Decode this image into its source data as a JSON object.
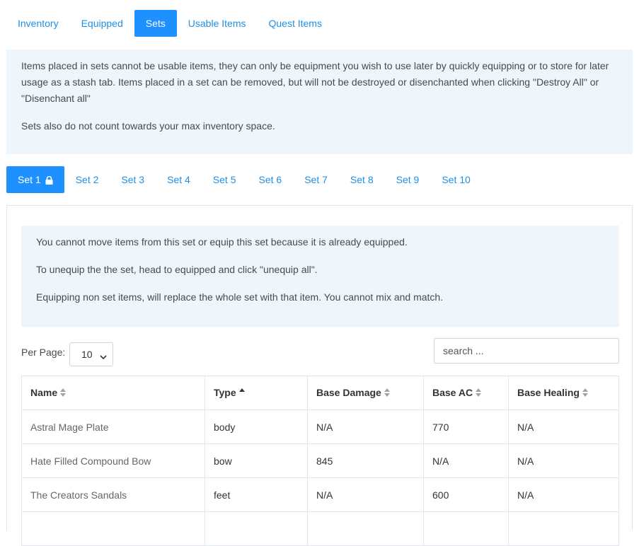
{
  "top_tabs": [
    {
      "label": "Inventory",
      "active": false
    },
    {
      "label": "Equipped",
      "active": false
    },
    {
      "label": "Sets",
      "active": true
    },
    {
      "label": "Usable Items",
      "active": false
    },
    {
      "label": "Quest Items",
      "active": false
    }
  ],
  "info": {
    "p1": "Items placed in sets cannot be usable items, they can only be equipment you wish to use later by quickly equipping or to store for later usage as a stash tab. Items placed in a set can be removed, but will not be destroyed or disenchanted when clicking \"Destroy All\" or \"Disenchant all\"",
    "p2": "Sets also do not count towards your max inventory space."
  },
  "set_tabs": [
    {
      "label": "Set 1",
      "active": true,
      "icon": "lock-icon"
    },
    {
      "label": "Set 2",
      "active": false
    },
    {
      "label": "Set 3",
      "active": false
    },
    {
      "label": "Set 4",
      "active": false
    },
    {
      "label": "Set 5",
      "active": false
    },
    {
      "label": "Set 6",
      "active": false
    },
    {
      "label": "Set 7",
      "active": false
    },
    {
      "label": "Set 8",
      "active": false
    },
    {
      "label": "Set 9",
      "active": false
    },
    {
      "label": "Set 10",
      "active": false
    }
  ],
  "notice": {
    "line1": "You cannot move items from this set or equip this set because it is already equipped.",
    "line2": "To unequip the the set, head to equipped and click \"unequip all\".",
    "line3": "Equipping non set items, will replace the whole set with that item. You cannot mix and match."
  },
  "per_page": {
    "label": "Per Page:",
    "value": "10"
  },
  "search": {
    "placeholder": "search ..."
  },
  "table": {
    "columns": [
      {
        "label": "Name",
        "sort": "both"
      },
      {
        "label": "Type",
        "sort": "asc"
      },
      {
        "label": "Base Damage",
        "sort": "both"
      },
      {
        "label": "Base AC",
        "sort": "both"
      },
      {
        "label": "Base Healing",
        "sort": "both"
      }
    ],
    "rows": [
      [
        "Astral Mage Plate",
        "body",
        "N/A",
        "770",
        "N/A"
      ],
      [
        "Hate Filled Compound Bow",
        "bow",
        "845",
        "N/A",
        "N/A"
      ],
      [
        "The Creators Sandals",
        "feet",
        "N/A",
        "600",
        "N/A"
      ]
    ]
  },
  "colors": {
    "accent": "#1e90ff",
    "info_bg": "#eef5fb"
  }
}
